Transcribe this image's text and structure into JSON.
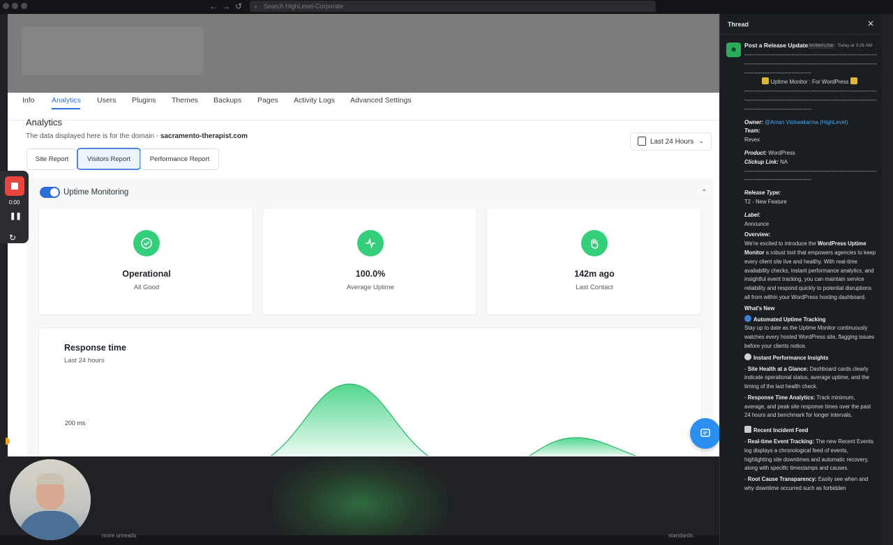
{
  "browser": {
    "search_placeholder": "Search HighLevel-Corporate"
  },
  "tabs": [
    "Info",
    "Analytics",
    "Users",
    "Plugins",
    "Themes",
    "Backups",
    "Pages",
    "Activity Logs",
    "Advanced Settings"
  ],
  "active_tab": "Analytics",
  "analytics": {
    "title": "Analytics",
    "domain_prefix": "The data displayed here is for the domain - ",
    "domain": "sacramento-therapist.com",
    "reports": [
      "Site Report",
      "Visitors Report",
      "Performance Report"
    ],
    "active_report": "Visitors Report",
    "date_range": "Last 24 Hours"
  },
  "uptime": {
    "label": "Uptime Monitoring",
    "enabled": true,
    "cards": [
      {
        "icon": "check-circle-icon",
        "value": "Operational",
        "label": "All Good"
      },
      {
        "icon": "activity-icon",
        "value": "100.0%",
        "label": "Average Uptime"
      },
      {
        "icon": "hand-icon",
        "value": "142m ago",
        "label": "Last Contact"
      }
    ]
  },
  "response": {
    "title": "Response time",
    "subtitle": "Last 24 hours",
    "axis_label": "200 ms"
  },
  "recorder": {
    "time": "0:00"
  },
  "thread": {
    "title": "Thread",
    "poster": "Post a Release Update",
    "badge": "WORKFLOW",
    "time": "Today at 3:26 AM",
    "dashes": "-----------------------------------------------------------------------------------------------------",
    "dashes_short": "-------------------------------------",
    "headline": "Uptime Monitor : For WordPress",
    "owner_label": "Owner:",
    "owner": "@Aman Vishwakarma (HighLevel)",
    "team_label": "Team:",
    "team": "Revex",
    "product_label": "Product:",
    "product": "WordPress",
    "clickup_label": "Clickup Link:",
    "clickup": "NA",
    "release_type_label": "Release Type:",
    "release_type": "T2 - New Feature",
    "label_label": "Label:",
    "label": "Announce",
    "overview_label": "Overview:",
    "overview_pre": "We're excited to introduce the ",
    "overview_bold": "WordPress Uptime Monitor",
    "overview_post": " a robust tool that empowers agencies to keep every client site live and healthy. With real-time availability checks, instant performance analytics, and insightful event tracking, you can maintain service reliability and respond quickly to potential disruptions all from within your WordPress hosting dashboard.",
    "whats_new": "What's New",
    "s1_title": "Automated Uptime Tracking",
    "s1_text": "Stay up to date as the Uptime Monitor continuously watches every hosted WordPress site, flagging issues before your clients notice.",
    "s2_title": "Instant Performance Insights",
    "s2_b1_label": "Site Health at a Glance:",
    "s2_b1_text": " Dashboard cards clearly indicate operational status, average uptime, and the timing of the last health check.",
    "s2_b2_label": "Response Time Analytics:",
    "s2_b2_text": " Track minimum, average, and peak site response times over the past 24 hours and benchmark for longer intervals.",
    "s3_title": "Recent Incident Feed",
    "s3_b1_label": "Real-time Event Tracking:",
    "s3_b1_text": " The new Recent Events log displays a chronological feed of events, highlighting site downtimes and automatic recovery, along with specific timestamps and causes.",
    "s3_b2_label": "Root Cause Transparency:",
    "s3_b2_text": " Easily see when and why downtime occurred such as forbidden"
  },
  "bottom": {
    "left_text": "more unreads",
    "right_text": "standards."
  },
  "colors": {
    "accent_blue": "#2f6ed8",
    "status_green": "#34cf7a",
    "thread_bg": "#1a1d21",
    "link": "#4fa7e8"
  }
}
